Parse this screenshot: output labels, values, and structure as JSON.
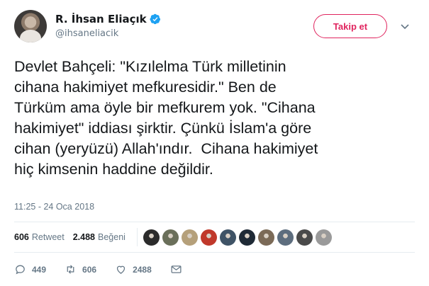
{
  "author": {
    "name": "R. İhsan Eliaçık",
    "handle": "@ihsaneliacik",
    "verified": true
  },
  "follow_button": {
    "label": "Takip et"
  },
  "tweet": {
    "text": "Devlet Bahçeli: \"Kızılelma Türk milletinin\ncihana hakimiyet mefkuresidir.\" Ben de\nTürküm ama öyle bir mefkurem yok. \"Cihana\nhakimiyet\" iddiası şirktir. Çünkü İslam'a göre\ncihan (yeryüzü) Allah'ındır.  Cihana hakimiyet\nhiç kimsenin haddine değildir.",
    "timestamp": "11:25 - 24 Oca 2018"
  },
  "stats": {
    "retweets": "606",
    "retweets_label": "Retweet",
    "likes": "2.488",
    "likes_label": "Beğeni",
    "liker_avatars": [
      {
        "color": "#2b2b2b"
      },
      {
        "color": "#6a6f5a"
      },
      {
        "color": "#b5a07a"
      },
      {
        "color": "#c0392b"
      },
      {
        "color": "#3f5366"
      },
      {
        "color": "#1f2a36"
      },
      {
        "color": "#7b6a57"
      },
      {
        "color": "#5d6d7e"
      },
      {
        "color": "#4a4a4a"
      },
      {
        "color": "#9a9a9a"
      }
    ]
  },
  "actions": {
    "replies": "449",
    "retweets": "606",
    "likes": "2488"
  },
  "colors": {
    "accent": "#e0245e",
    "verified": "#1da1f2",
    "muted": "#657786"
  }
}
